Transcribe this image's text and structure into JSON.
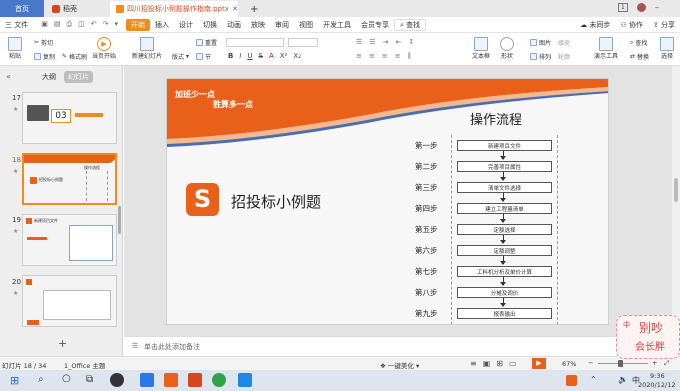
{
  "tabs": {
    "home": "首页",
    "daoke": "稻壳",
    "file": "四川招投标小例题操作指南.pptx"
  },
  "menu": {
    "file": "三 文件",
    "items": [
      "开始",
      "插入",
      "设计",
      "切换",
      "动画",
      "放映",
      "审阅",
      "视图",
      "开发工具",
      "会员专享"
    ],
    "search": "查找",
    "sync": "未同步",
    "collab": "协作",
    "share": "分享"
  },
  "ribbon": {
    "paste": "粘贴",
    "cut": "剪切",
    "copy": "复制",
    "format_painter": "格式刷",
    "start_from_current": "当页开始",
    "new_slide": "新建幻灯片",
    "layout": "版式",
    "section": "节",
    "reset": "重置",
    "textbox": "文本框",
    "shape": "形状",
    "arrange": "排列",
    "image": "图片",
    "fill": "填充",
    "outline": "轮廓",
    "presenter_tools": "演示工具",
    "find": "查找",
    "replace": "替换",
    "select": "选择"
  },
  "panel": {
    "tab_outline": "大纲",
    "tab_slides": "幻灯片"
  },
  "thumbnails": [
    {
      "num": "17"
    },
    {
      "num": "18",
      "title": "招投标小例题",
      "header": "操作流程"
    },
    {
      "num": "19",
      "title": "新建项目文件"
    },
    {
      "num": "20"
    }
  ],
  "slide": {
    "slogan1": "加班少一点",
    "slogan2": "胜算多一点",
    "logo_letter": "S",
    "title": "招投标小例题",
    "flow_title": "操作流程",
    "steps": [
      {
        "label": "第一步",
        "text": "新建项目文件"
      },
      {
        "label": "第二步",
        "text": "完善项目属性"
      },
      {
        "label": "第三步",
        "text": "清单文件选择"
      },
      {
        "label": "第四步",
        "text": "建立工程量清单"
      },
      {
        "label": "第五步",
        "text": "定额选择"
      },
      {
        "label": "第六步",
        "text": "定额调整"
      },
      {
        "label": "第七步",
        "text": "工料机分析及单价计算"
      },
      {
        "label": "第八步",
        "text": "分摊及调价"
      },
      {
        "label": "第九步",
        "text": "报表输出"
      }
    ]
  },
  "notes_placeholder": "单击此处添加备注",
  "status": {
    "slide_counter": "幻灯片 18 / 34",
    "theme": "1_Office 主题",
    "beautify": "一键美化",
    "zoom": "67%"
  },
  "taskbar": {
    "time": "9:36",
    "date": "2020/12/12",
    "ime": "中"
  },
  "sticker": {
    "line1": "别吵",
    "line2": "会长胖"
  },
  "colors": {
    "accent": "#f08c1d",
    "brand": "#d24a1b",
    "slide_band": "#e8601a",
    "blue": "#4a78c8"
  }
}
